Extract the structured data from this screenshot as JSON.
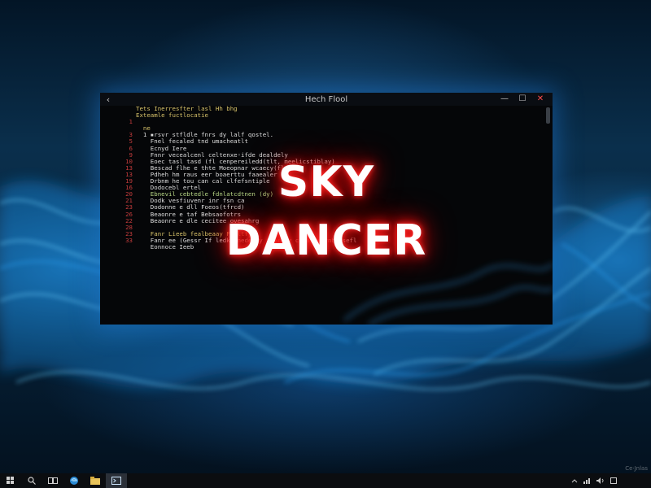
{
  "window": {
    "title": "Hech Flool",
    "back": "‹",
    "minimize": "—",
    "maximize": "☐",
    "close": "✕"
  },
  "code_lines": [
    {
      "n": "",
      "t": "Tets Inerresfter lasl Hh bhg",
      "c": "yellow"
    },
    {
      "n": "",
      "t": "Exteamle fuctlocatie",
      "c": "yellow"
    },
    {
      "n": "1",
      "t": "",
      "c": ""
    },
    {
      "n": "",
      "t": "  ne",
      "c": "yellow"
    },
    {
      "n": "3",
      "t": "  1 ▪rsvr stfldle fnrs dy lalf qostel.",
      "c": ""
    },
    {
      "n": "5",
      "t": "    Fnel fecaled tnd umacheatlt",
      "c": ""
    },
    {
      "n": "6",
      "t": "    Ecnyd Iere",
      "c": ""
    },
    {
      "n": "9",
      "t": "    Fnnr vecealcenl celtenxe◦ifde dealdely",
      "c": ""
    },
    {
      "n": "10",
      "t": "    Eoec tasl tasd (fl cenpereiledd(tlt, meelicstiblay)",
      "c": ""
    },
    {
      "n": "13",
      "t": "    Bescad flhe e thte Moeopnar wcaecy(fl",
      "c": ""
    },
    {
      "n": "13",
      "t": "    Pdheh hm raus eer boaerttu faaealer",
      "c": ""
    },
    {
      "n": "19",
      "t": "    Drbnm he tou can cal clfefsntiple",
      "c": ""
    },
    {
      "n": "16",
      "t": "    Dodocebl ertel",
      "c": ""
    },
    {
      "n": "20",
      "t": "    Ebnevil cebtedle fdnlatcdtnen (dy)",
      "c": "green"
    },
    {
      "n": "21",
      "t": "    Dodk vesfiuvenr inr fsn ca",
      "c": ""
    },
    {
      "n": "23",
      "t": "    Dodonne e dll Foeos(tfrcd)",
      "c": ""
    },
    {
      "n": "26",
      "t": "    Beaonre e taf Bebsaofotrs",
      "c": ""
    },
    {
      "n": "22",
      "t": "    Beaonre e dle cecitee ovesahrg",
      "c": ""
    },
    {
      "n": "28",
      "t": "",
      "c": ""
    },
    {
      "n": "23",
      "t": "    Fanr Lieeb fealbeaay Fr ltfy",
      "c": "yellow"
    },
    {
      "n": "33",
      "t": "    Fanr ee (Gessr If ledk fnedenay fner hy cofailecrnhtlsefl",
      "c": ""
    },
    {
      "n": "",
      "t": "    Eonnoce Ieeb",
      "c": ""
    }
  ],
  "overlay": {
    "line1": "SKY",
    "line2": "DANCER"
  },
  "taskbar": {
    "items": [
      "start",
      "search",
      "task-view",
      "edge",
      "file-explorer",
      "terminal"
    ]
  },
  "watermark": "Ce·Jnlas"
}
